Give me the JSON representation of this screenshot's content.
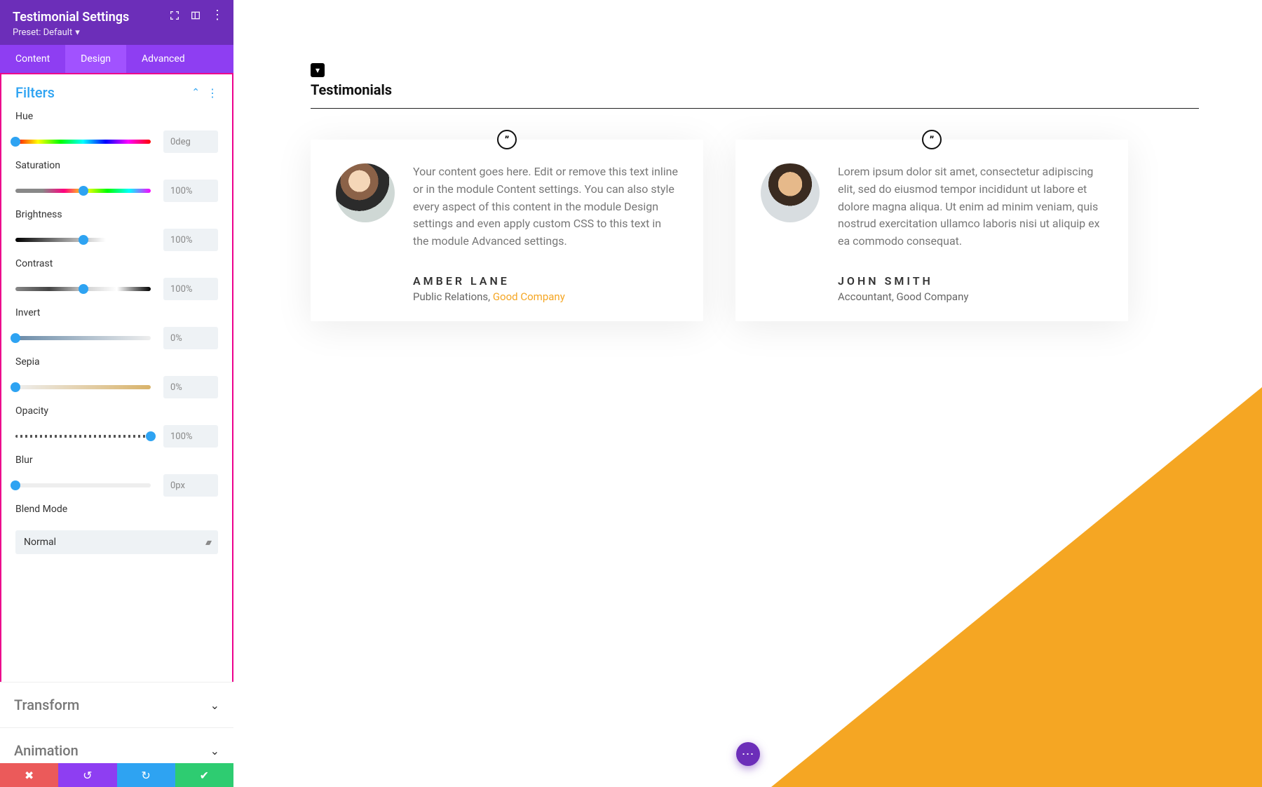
{
  "sidebar": {
    "title": "Testimonial Settings",
    "preset": "Preset: Default",
    "tabs": {
      "content": "Content",
      "design": "Design",
      "advanced": "Advanced"
    },
    "filters_section": "Filters",
    "controls": {
      "hue": {
        "label": "Hue",
        "value": "0deg",
        "pos": 0
      },
      "saturation": {
        "label": "Saturation",
        "value": "100%",
        "pos": 50
      },
      "brightness": {
        "label": "Brightness",
        "value": "100%",
        "pos": 50
      },
      "contrast": {
        "label": "Contrast",
        "value": "100%",
        "pos": 50
      },
      "invert": {
        "label": "Invert",
        "value": "0%",
        "pos": 0
      },
      "sepia": {
        "label": "Sepia",
        "value": "0%",
        "pos": 0
      },
      "opacity": {
        "label": "Opacity",
        "value": "100%",
        "pos": 100
      },
      "blur": {
        "label": "Blur",
        "value": "0px",
        "pos": 0
      }
    },
    "blend_mode": {
      "label": "Blend Mode",
      "value": "Normal"
    },
    "transform_section": "Transform",
    "animation_section": "Animation"
  },
  "canvas": {
    "heading": "Testimonials",
    "cards": [
      {
        "text": "Your content goes here. Edit or remove this text inline or in the module Content settings. You can also style every aspect of this content in the module Design settings and even apply custom CSS to this text in the module Advanced settings.",
        "author": "AMBER LANE",
        "role": "Public Relations, ",
        "company": "Good Company",
        "company_link": true
      },
      {
        "text": "Lorem ipsum dolor sit amet, consectetur adipiscing elit, sed do eiusmod tempor incididunt ut labore et dolore magna aliqua. Ut enim ad minim veniam, quis nostrud exercitation ullamco laboris nisi ut aliquip ex ea commodo consequat.",
        "author": "JOHN SMITH",
        "role": "Accountant, ",
        "company": "Good Company",
        "company_link": false
      }
    ]
  }
}
